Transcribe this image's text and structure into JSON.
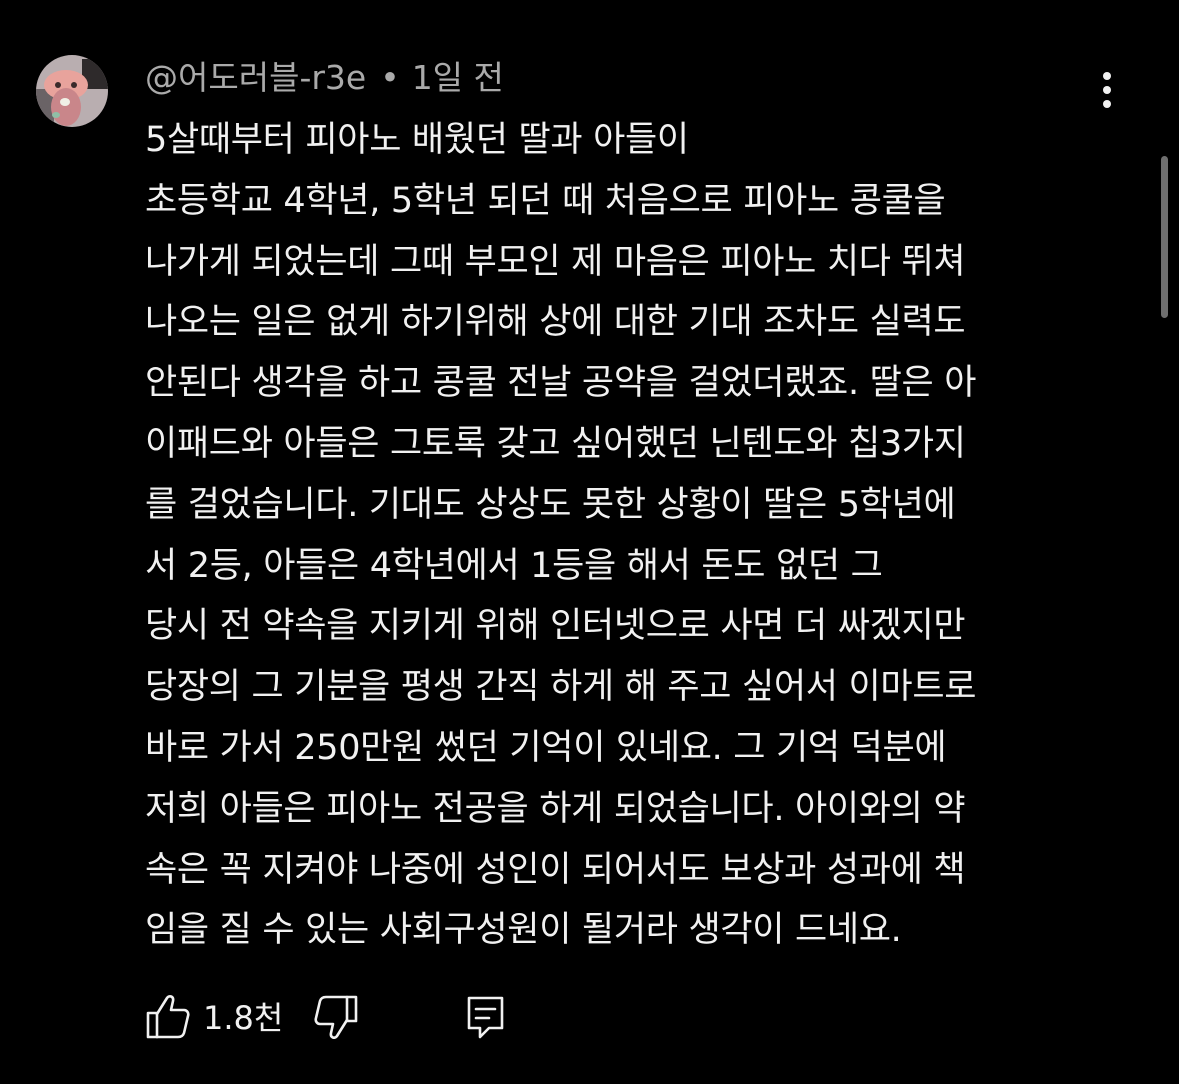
{
  "comment": {
    "avatar_icon": "user-avatar-icon",
    "author": "@어도러블-r3e",
    "separator": "•",
    "time": "1일 전",
    "more_icon": "more-vertical-icon",
    "lines": [
      "5살때부터 피아노 배웠던 딸과 아들이",
      "초등학교 4학년, 5학년 되던 때 처음으로 피아노 콩쿨을",
      "나가게 되었는데 그때 부모인 제 마음은 피아노 치다 뛰쳐",
      "나오는 일은 없게 하기위해 상에 대한 기대 조차도 실력도",
      "안된다 생각을 하고 콩쿨 전날 공약을 걸었더랬죠. 딸은 아",
      "이패드와 아들은 그토록 갖고 싶어했던 닌텐도와 칩3가지",
      "를 걸었습니다. 기대도 상상도 못한 상황이 딸은 5학년에",
      "서 2등, 아들은 4학년에서 1등을 해서 돈도 없던 그",
      "당시 전 약속을 지키게 위해 인터넷으로 사면 더 싸겠지만",
      "당장의 그 기분을 평생 간직 하게 해 주고 싶어서 이마트로",
      "바로 가서 250만원 썼던 기억이 있네요. 그 기억 덕분에",
      "저희 아들은 피아노 전공을 하게 되었습니다. 아이와의 약",
      "속은 꼭 지켜야 나중에 성인이 되어서도 보상과 성과에 책",
      "임을 질 수 있는 사회구성원이 될거라 생각이 드네요."
    ],
    "actions": {
      "like_icon": "thumbs-up-icon",
      "like_count": "1.8천",
      "dislike_icon": "thumbs-down-icon",
      "reply_icon": "reply-comment-icon"
    }
  },
  "colors": {
    "background": "#000000",
    "text_primary": "#f1f1f1",
    "text_secondary": "#aaaaaa",
    "scrollbar": "#6f6f6f"
  }
}
